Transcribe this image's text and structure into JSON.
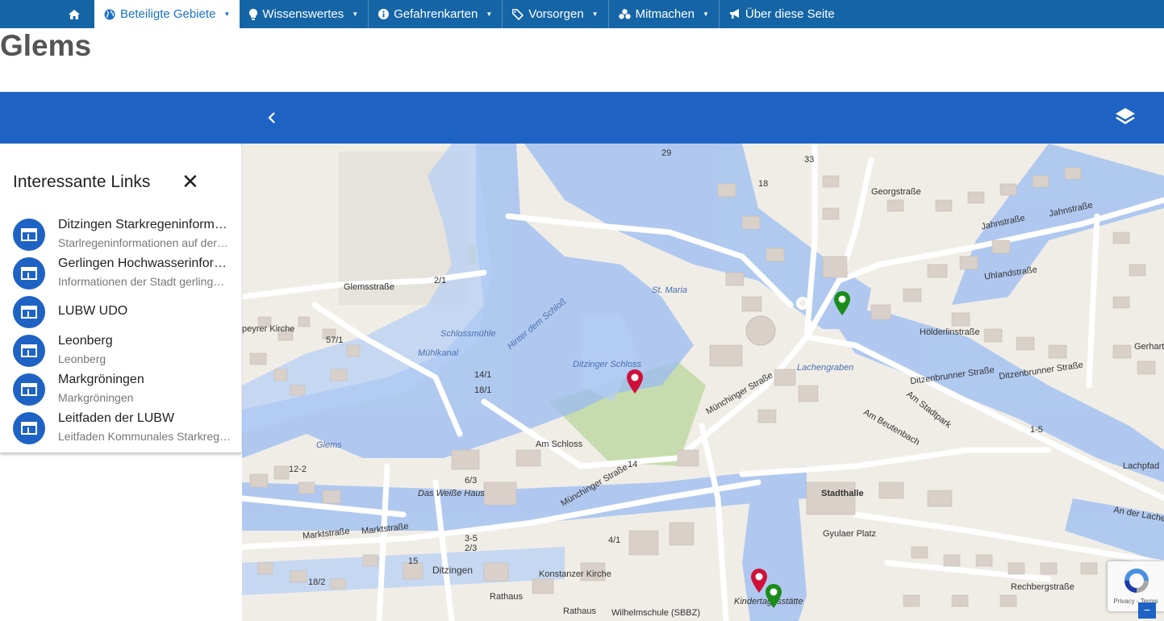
{
  "nav": {
    "items": [
      {
        "label": "Beteiligte Gebiete",
        "icon": "globe-icon",
        "dropdown": true,
        "active": true
      },
      {
        "label": "Wissenswertes",
        "icon": "lightbulb-icon",
        "dropdown": true
      },
      {
        "label": "Gefahrenkarten",
        "icon": "info-icon",
        "dropdown": true
      },
      {
        "label": "Vorsorgen",
        "icon": "tag-icon",
        "dropdown": true
      },
      {
        "label": "Mitmachen",
        "icon": "users-icon",
        "dropdown": true
      },
      {
        "label": "Über diese Seite",
        "icon": "bullhorn-icon",
        "dropdown": false
      }
    ],
    "home_icon": "home-icon"
  },
  "page": {
    "title": "Glems"
  },
  "colors": {
    "nav": "#1565a6",
    "toolbar": "#1e63c4",
    "accent": "#1a73c5",
    "pin_red": "#d0103a",
    "pin_green": "#1a8c1a"
  },
  "panel": {
    "title": "Interessante Links",
    "close_icon": "close-icon",
    "links": [
      {
        "title": "Ditzingen Starkregeninformationen",
        "subtitle": "Starlregeninformationen auf der Seite der Stadt Ditzingen"
      },
      {
        "title": "Gerlingen Hochwasserinformationen",
        "subtitle": "Informationen der Stadt gerlingen zum Hochwasser"
      },
      {
        "title": "LUBW UDO",
        "subtitle": ""
      },
      {
        "title": "Leonberg",
        "subtitle": "Leonberg"
      },
      {
        "title": "Markgröningen",
        "subtitle": "Markgröningen"
      },
      {
        "title": "Leitfaden der LUBW",
        "subtitle": "Leitfaden Kommunales Starkregenrisikomanagement"
      }
    ]
  },
  "map": {
    "labels": {
      "glemsstrasse": "Glemsstraße",
      "peyrer": "peyrer Kirche",
      "glemsb": "Glems",
      "schlossmuehle": "Schlossmühle",
      "muehlkanal": "Mühlkanal",
      "hinter_schloss": "Hinter dem Schloß",
      "ditzinger_schloss": "Ditzinger Schloss",
      "st_maria": "St. Maria",
      "am_schloss": "Am Schloss",
      "das_weisse_haus": "Das Weiße Haus",
      "ditzingen": "Ditzingen",
      "konstanzer": "Konstanzer Kirche",
      "rathaus": "Rathaus",
      "wilhelmschule": "Wilhelmschule (SBBZ)",
      "stadthalle": "Stadthalle",
      "gyulaer": "Gyulaer Platz",
      "kindertagesstaette": "Kindertagesstätte",
      "georgstrasse": "Georgstraße",
      "jahnstrasse": "Jahnstraße",
      "uhlandstrasse": "Uhlandstraße",
      "hoelderlinstrasse": "Hölderlinstraße",
      "lachengraben": "Lachengraben",
      "ditzenbrunner": "Ditzenbrunner Straße",
      "am_beutenbach": "Am Beutenbach",
      "am_stadtpark": "Am Stadtpark",
      "lachpfad": "Lachpfad",
      "an_der_lache": "An der Lache",
      "rechbergstrasse": "Rechbergstraße",
      "marktstrasse": "Marktstraße",
      "muenchinger": "Münchinger Straße",
      "gerhart": "Gerhart-Ha",
      "n_57_1": "57/1",
      "n_2_1": "2/1",
      "n_14_1": "14/1",
      "n_18_1": "18/1",
      "n_14": "14",
      "n_29": "29",
      "n_18": "18",
      "n_33": "33",
      "n_4_1": "4/1",
      "n_3_5": "3-5",
      "n_2_3": "2/3",
      "n_15": "15",
      "n_18_2": "18/2",
      "n_1_5": "1-5",
      "n_12_2": "12-2",
      "n_6_3": "6/3"
    },
    "pins": [
      {
        "name": "pin-schloss",
        "color": "red"
      },
      {
        "name": "pin-georg",
        "color": "green"
      },
      {
        "name": "pin-kita-red",
        "color": "red"
      },
      {
        "name": "pin-kita-green",
        "color": "green"
      }
    ]
  },
  "recaptcha": {
    "text": "Privacy - Terms"
  },
  "zoom": {
    "minus": "−"
  }
}
